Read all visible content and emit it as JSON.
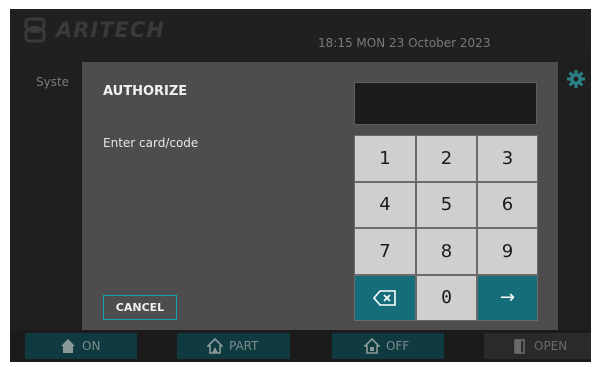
{
  "header": {
    "brand": "ARITECH",
    "datetime": "18:15 MON 23 October 2023"
  },
  "background_screen": {
    "partial_label": "Syste"
  },
  "bottom_bar": {
    "buttons": [
      {
        "label": "ON",
        "icon": "house-icon"
      },
      {
        "label": "PART",
        "icon": "house-part-icon"
      },
      {
        "label": "OFF",
        "icon": "house-lock-icon"
      },
      {
        "label": "OPEN",
        "icon": "door-icon"
      }
    ]
  },
  "dialog": {
    "title": "AUTHORIZE",
    "prompt": "Enter card/code",
    "code_value": "",
    "cancel_label": "CANCEL",
    "keys": [
      "1",
      "2",
      "3",
      "4",
      "5",
      "6",
      "7",
      "8",
      "9",
      "⌫",
      "0",
      "→"
    ]
  },
  "colors": {
    "accent_teal": "#146d79",
    "key_gray": "#cfcfcf",
    "dialog_bg": "#4d4d4d",
    "cancel_border": "#18a0ae"
  }
}
